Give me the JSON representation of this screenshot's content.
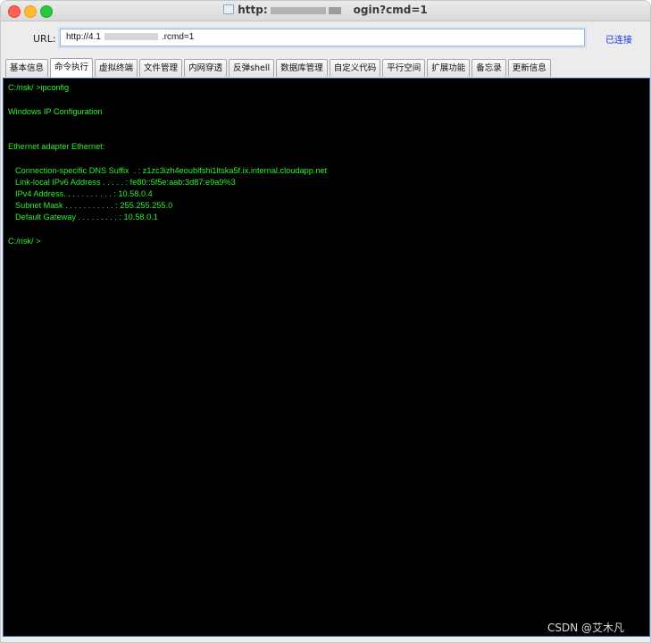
{
  "window": {
    "title_left": "http:",
    "title_right": "ogin?cmd=1"
  },
  "url": {
    "label": "URL:",
    "value": "http://4.1",
    "value_suffix": ".rcmd=1",
    "connect_label": "已连接"
  },
  "tabs": [
    {
      "label": "基本信息"
    },
    {
      "label": "命令执行",
      "active": true
    },
    {
      "label": "虚拟终端"
    },
    {
      "label": "文件管理"
    },
    {
      "label": "内网穿透"
    },
    {
      "label": "反弹shell"
    },
    {
      "label": "数据库管理"
    },
    {
      "label": "自定义代码"
    },
    {
      "label": "平行空间"
    },
    {
      "label": "扩展功能"
    },
    {
      "label": "备忘录"
    },
    {
      "label": "更新信息"
    }
  ],
  "terminal": {
    "prompt1": "C:/risk/ >ipconfig",
    "heading": "Windows IP Configuration",
    "adapter": "Ethernet adapter Ethernet:",
    "dns_suffix": "Connection-specific DNS Suffix  . : z1zc3izh4eoublfshi1ltska5f.ix.internal.cloudapp.net",
    "ipv6": "Link-local IPv6 Address . . . . . : fe80::5f5e:aab:3d87:e9a9%3",
    "ipv4": "IPv4 Address. . . . . . . . . . . : 10.58.0.4",
    "subnet": "Subnet Mask . . . . . . . . . . . : 255.255.255.0",
    "gateway": "Default Gateway . . . . . . . . . : 10.58.0.1",
    "prompt2": "C:/risk/ >",
    "text_color": "#2bf12b",
    "background": "#000000"
  },
  "watermark": "CSDN @艾木凡"
}
